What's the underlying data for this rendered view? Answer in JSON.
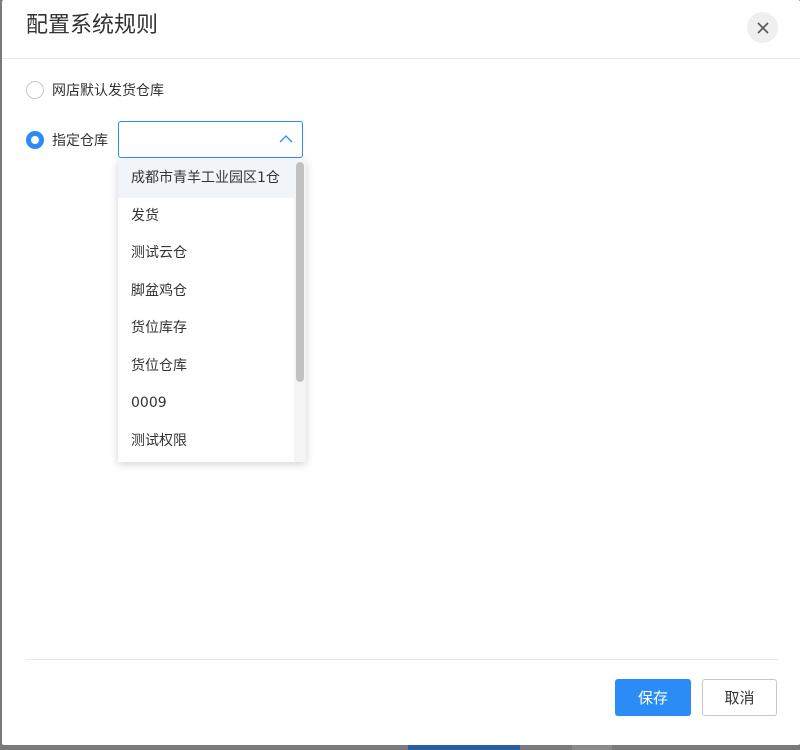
{
  "dialog": {
    "title": "配置系统规则"
  },
  "options": {
    "default_warehouse_label": "网店默认发货仓库",
    "specified_warehouse_label": "指定仓库",
    "selected": "specified"
  },
  "warehouse_select": {
    "value": "",
    "expanded": true,
    "items": [
      "成都市青羊工业园区1仓",
      "发货",
      "测试云仓",
      "脚盆鸡仓",
      "货位库存",
      "货位仓库",
      "0009",
      "测试权限"
    ]
  },
  "footer": {
    "save_label": "保存",
    "cancel_label": "取消"
  },
  "colors": {
    "accent": "#2b8cf5"
  },
  "icons": {
    "close": "close-icon",
    "chevron": "chevron-up-icon"
  }
}
